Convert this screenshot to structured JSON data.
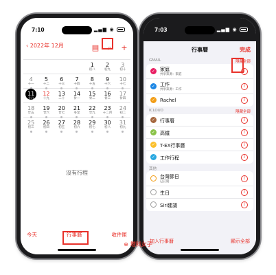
{
  "left_phone": {
    "status_time": "7:10",
    "status_icons": "▂▄▆ ◉",
    "back_label": "2022年 12月",
    "nav_icons": [
      "calendar-icon",
      "search-icon",
      "plus-icon"
    ],
    "weeks": [
      [
        {
          "d": "",
          "l": ""
        },
        {
          "d": "",
          "l": ""
        },
        {
          "d": "",
          "l": ""
        },
        {
          "d": "",
          "l": ""
        },
        {
          "d": "1",
          "l": "初八"
        },
        {
          "d": "2",
          "l": "初九"
        },
        {
          "d": "3",
          "l": "初十"
        }
      ],
      [
        {
          "d": "4",
          "l": "十一"
        },
        {
          "d": "5",
          "l": "十二"
        },
        {
          "d": "6",
          "l": "十三"
        },
        {
          "d": "7",
          "l": "十四"
        },
        {
          "d": "8",
          "l": "十五"
        },
        {
          "d": "9",
          "l": "十六"
        },
        {
          "d": "10",
          "l": "十七"
        }
      ],
      [
        {
          "d": "11",
          "l": "十八"
        },
        {
          "d": "12",
          "l": "十九"
        },
        {
          "d": "13",
          "l": "二十"
        },
        {
          "d": "14",
          "l": "廿一"
        },
        {
          "d": "15",
          "l": "廿二"
        },
        {
          "d": "16",
          "l": "廿三"
        },
        {
          "d": "17",
          "l": "廿四"
        }
      ],
      [
        {
          "d": "18",
          "l": "廿五"
        },
        {
          "d": "19",
          "l": "廿六"
        },
        {
          "d": "20",
          "l": "廿七"
        },
        {
          "d": "21",
          "l": "冬至"
        },
        {
          "d": "22",
          "l": "廿九"
        },
        {
          "d": "23",
          "l": "十二月"
        },
        {
          "d": "24",
          "l": "初二"
        }
      ],
      [
        {
          "d": "25",
          "l": "初三"
        },
        {
          "d": "26",
          "l": "初四"
        },
        {
          "d": "27",
          "l": "初五"
        },
        {
          "d": "28",
          "l": "初六"
        },
        {
          "d": "29",
          "l": "初七"
        },
        {
          "d": "30",
          "l": "初八"
        },
        {
          "d": "31",
          "l": "初九"
        }
      ]
    ],
    "no_events": "沒有行程",
    "bottom": {
      "today": "今天",
      "calendars": "行事曆",
      "inbox": "收件匣"
    }
  },
  "right_phone": {
    "status_time": "7:03",
    "status_icons": "▂▄▆ ◉",
    "title": "行事曆",
    "done": "完成",
    "sections": [
      {
        "header": "GMAIL",
        "hide_all": "隱藏全部",
        "items": [
          {
            "name": "家庭",
            "sub": "共享來源：家庭",
            "color": "#e91e63",
            "checked": true
          },
          {
            "name": "工作",
            "sub": "共享來源：工作",
            "color": "#1e88e5",
            "checked": true
          },
          {
            "name": "Rachel",
            "sub": "",
            "color": "#f29d16",
            "checked": true
          }
        ]
      },
      {
        "header": "ICLOUD",
        "hide_all": "隱藏全部",
        "items": [
          {
            "name": "行事曆",
            "sub": "",
            "color": "#a5673f",
            "checked": true
          },
          {
            "name": "高鐵",
            "sub": "",
            "color": "#8bc34a",
            "checked": true
          },
          {
            "name": "T-EX行事曆",
            "sub": "",
            "color": "#fbc02d",
            "checked": true
          },
          {
            "name": "工作行程",
            "sub": "",
            "color": "#29a8e0",
            "checked": true
          }
        ]
      },
      {
        "header": "其他",
        "hide_all": "",
        "items": [
          {
            "name": "台灣節日",
            "sub": "已訂閱",
            "color": "#f29d16",
            "checked": false
          },
          {
            "name": "生日",
            "sub": "",
            "color": "#9e9e9e",
            "checked": false
          },
          {
            "name": "Siri建議",
            "sub": "",
            "color": "#9e9e9e",
            "checked": false
          }
        ]
      }
    ],
    "bottom": {
      "add": "加入行事曆",
      "show_all": "顯示全部"
    }
  },
  "colors": {
    "accent": "#e8322b"
  },
  "watermark": "⊕ 塔科女子"
}
